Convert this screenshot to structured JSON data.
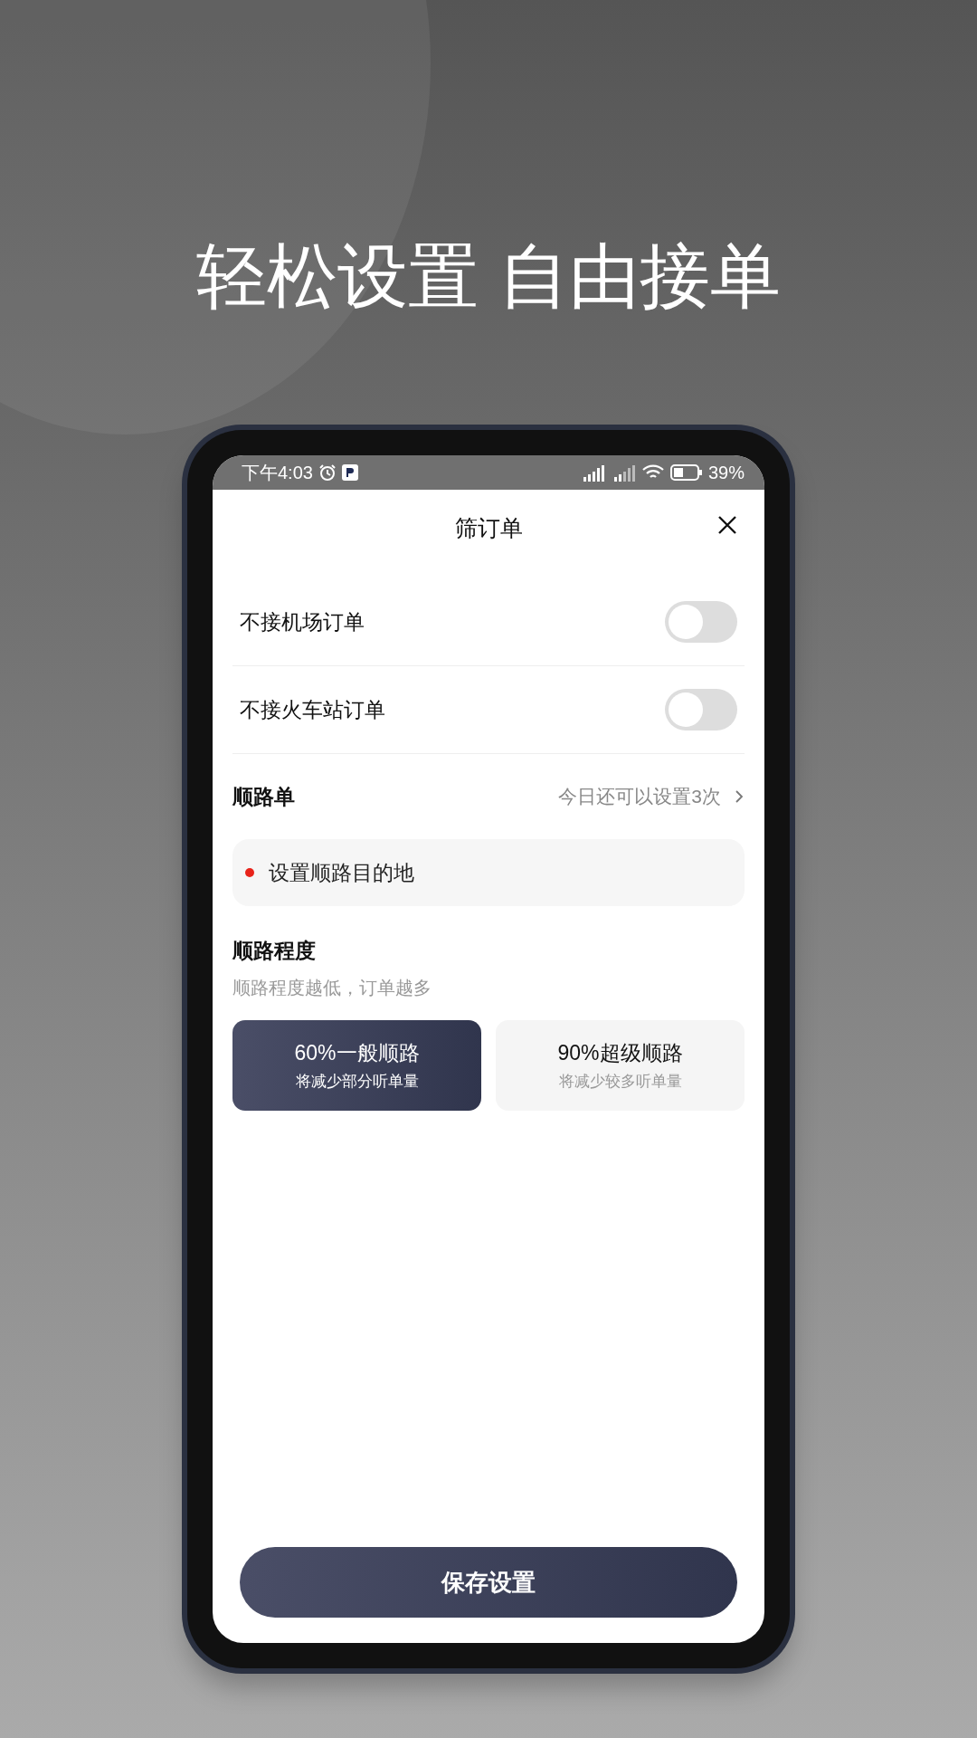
{
  "headline": "轻松设置 自由接单",
  "status_bar": {
    "time": "下午4:03",
    "battery": "39%"
  },
  "sheet": {
    "title": "筛订单"
  },
  "toggles": [
    {
      "label": "不接机场订单",
      "on": false
    },
    {
      "label": "不接火车站订单",
      "on": false
    }
  ],
  "route": {
    "title": "顺路单",
    "quota": "今日还可以设置3次",
    "destination": "设置顺路目的地"
  },
  "degree": {
    "title": "顺路程度",
    "hint": "顺路程度越低，订单越多",
    "options": [
      {
        "title": "60%一般顺路",
        "subtitle": "将减少部分听单量",
        "selected": true
      },
      {
        "title": "90%超级顺路",
        "subtitle": "将减少较多听单量",
        "selected": false
      }
    ]
  },
  "save_button": "保存设置"
}
